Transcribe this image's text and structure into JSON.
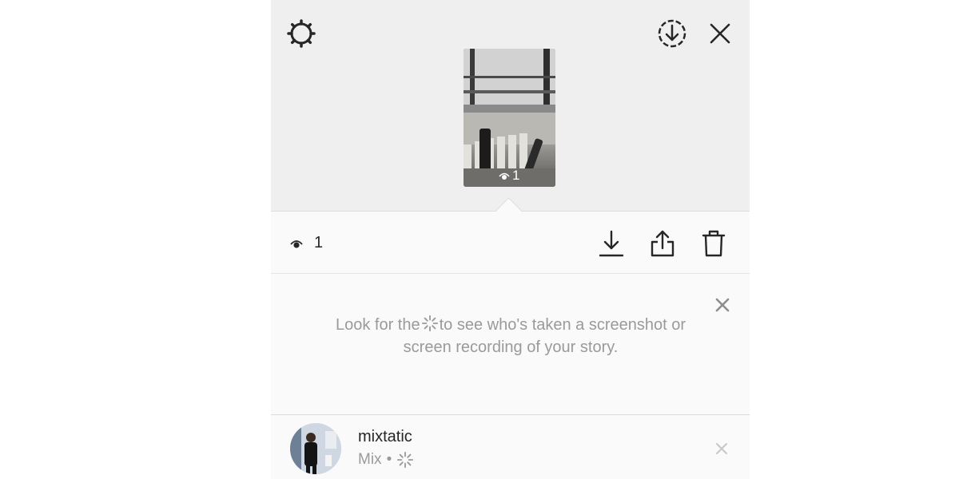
{
  "header": {
    "settings_icon": "gear-icon",
    "download_icon": "download-circle-icon",
    "close_icon": "close-icon"
  },
  "preview": {
    "view_count": "1",
    "view_icon": "eye-icon"
  },
  "actions": {
    "view_count": "1",
    "icons": [
      "download-icon",
      "share-icon",
      "trash-icon"
    ]
  },
  "notice": {
    "text_before": "Look for the",
    "text_after": "to see who's taken a screenshot or screen recording of your story.",
    "icon": "screenshot-burst-icon"
  },
  "viewers": [
    {
      "username": "mixtatic",
      "name": "Mix",
      "separator": "•"
    }
  ],
  "colors": {
    "preview_bg": "#efefef",
    "panel_bg": "#fafafa",
    "text_primary": "#262626",
    "text_secondary": "#9a9a9a"
  }
}
